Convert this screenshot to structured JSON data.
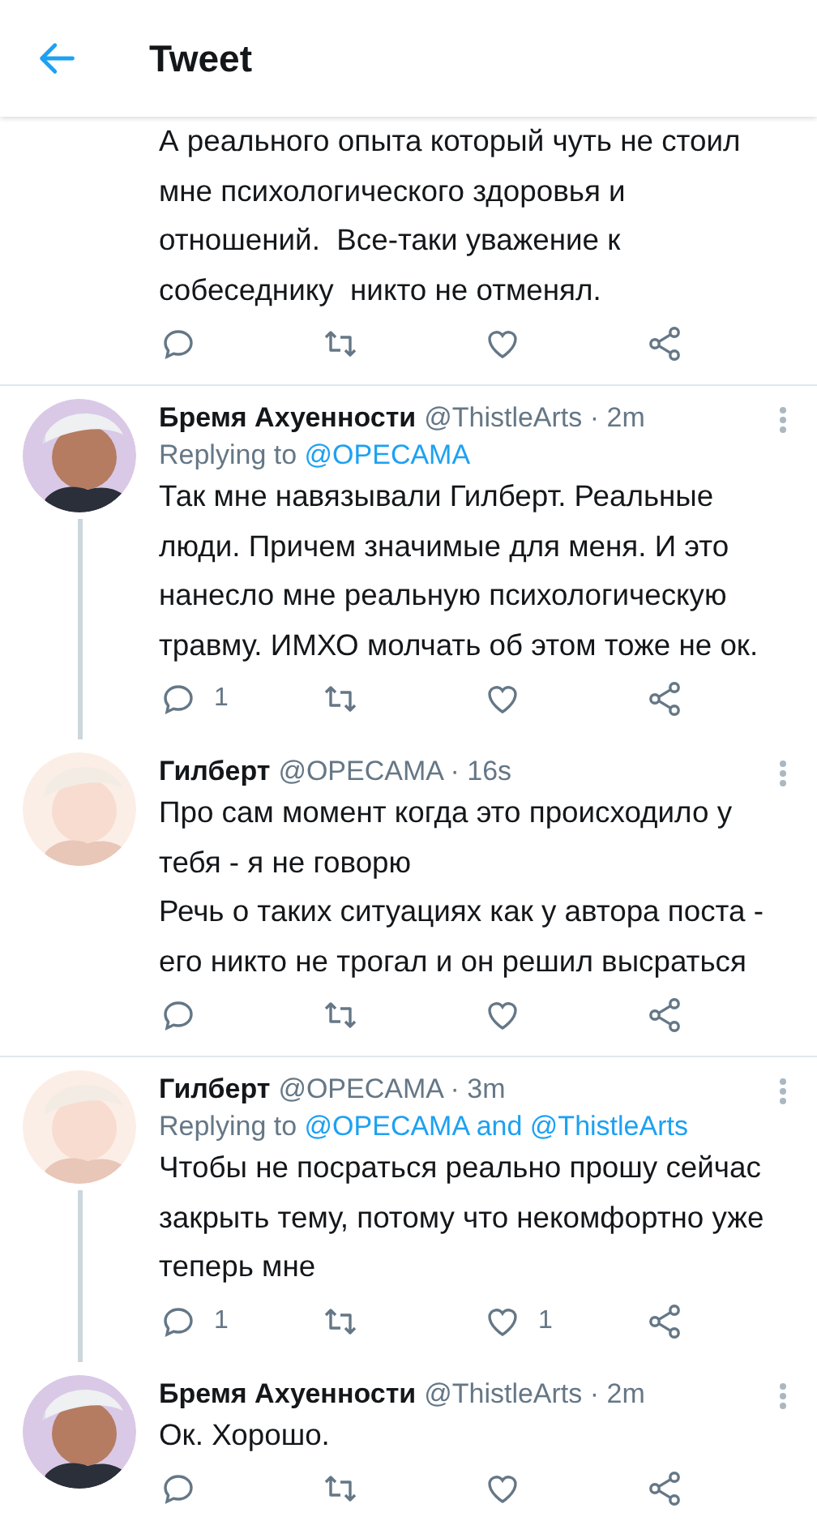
{
  "header": {
    "title": "Tweet"
  },
  "tweets": [
    {
      "kind": "continuation",
      "text": "А реального опыта который чуть не стоил мне психологического здоровья и отношений.  Все-таки уважение к собеседнику  никто не отменял.",
      "divider_after": true
    },
    {
      "kind": "full",
      "name": "Бремя Ахуенности",
      "meta": "@ThistleArts · 2m",
      "replying_label": "Replying to",
      "replying_to": "@OPECAMA",
      "text": "Так мне навязывали Гилберт. Реальные люди. Причем значимые для меня. И это нанесло мне реальную психологическую травму. ИМХО молчать об этом тоже не ок.",
      "reply_count": "1",
      "thread_down": true,
      "divider_after": false
    },
    {
      "kind": "full",
      "name": "Гилберт",
      "meta": "@OPECAMA · 16s",
      "text": "Про сам момент когда это происходило у тебя - я не говорю\nРечь о таких ситуациях как у автора поста - его никто не трогал и он решил высраться",
      "thread_down": false,
      "divider_after": true
    },
    {
      "kind": "full",
      "name": "Гилберт",
      "meta": "@OPECAMA · 3m",
      "replying_label": "Replying to",
      "replying_to": "@OPECAMA and @ThistleArts",
      "text": "Чтобы не посраться реально прошу сейчас закрыть тему, потому что некомфортно уже теперь мне",
      "reply_count": "1",
      "like_count": "1",
      "thread_down": true,
      "divider_after": false
    },
    {
      "kind": "full",
      "name": "Бремя Ахуенности",
      "meta": "@ThistleArts · 2m",
      "text": "Ок. Хорошо.",
      "thread_down": false,
      "divider_after": false
    }
  ]
}
